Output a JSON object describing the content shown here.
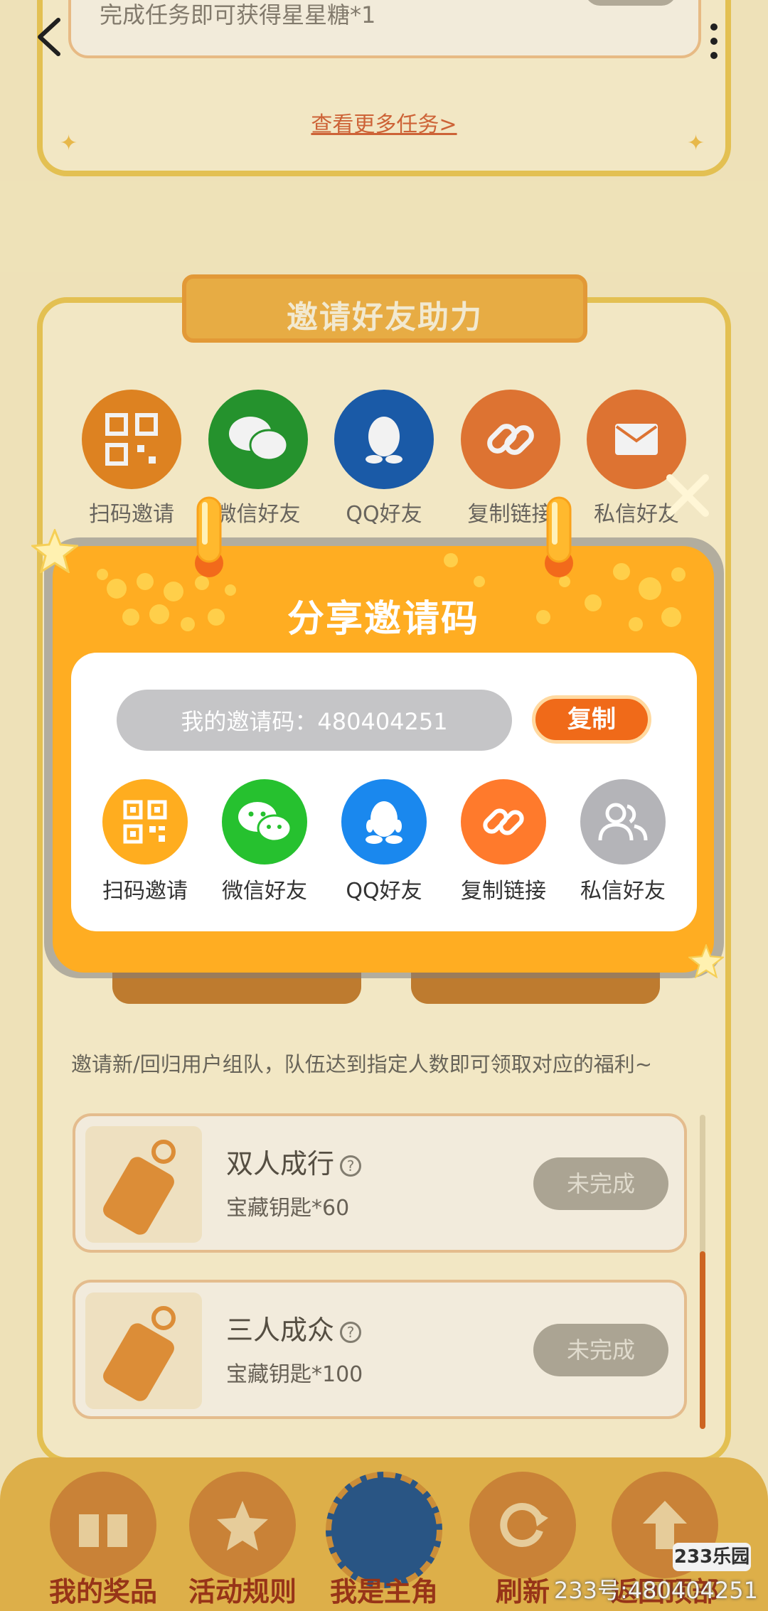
{
  "top_section": {
    "task_text": "完成任务即可获得星星糖*1",
    "more_tasks_link": "查看更多任务>"
  },
  "invite_section": {
    "banner_title": "邀请好友助力",
    "share_options": [
      {
        "label": "扫码邀请",
        "icon": "qr-code-icon",
        "color": "#e98a23"
      },
      {
        "label": "微信好友",
        "icon": "wechat-icon",
        "color": "#279a30"
      },
      {
        "label": "QQ好友",
        "icon": "qq-icon",
        "color": "#1c5fb0"
      },
      {
        "label": "复制链接",
        "icon": "link-icon",
        "color": "#e97a35"
      },
      {
        "label": "私信好友",
        "icon": "message-icon",
        "color": "#e97a35"
      }
    ],
    "team_description": "邀请新/回归用户组队，队伍达到指定人数即可领取对应的福利~",
    "rewards": [
      {
        "title": "双人成行",
        "subtitle": "宝藏钥匙*60",
        "status": "未完成"
      },
      {
        "title": "三人成众",
        "subtitle": "宝藏钥匙*100",
        "status": "未完成"
      }
    ]
  },
  "modal": {
    "title": "分享邀请码",
    "invite_code_label": "我的邀请码：480404251",
    "copy_button": "复制",
    "share_options": [
      {
        "label": "扫码邀请",
        "icon": "qr-code-icon",
        "color": "#ffad1f"
      },
      {
        "label": "微信好友",
        "icon": "wechat-icon",
        "color": "#26c12f"
      },
      {
        "label": "QQ好友",
        "icon": "qq-icon",
        "color": "#1a88ee"
      },
      {
        "label": "复制链接",
        "icon": "link-icon",
        "color": "#ff7a2c"
      },
      {
        "label": "私信好友",
        "icon": "friends-icon",
        "color": "#b4b4b8"
      }
    ]
  },
  "bottom_nav": {
    "items": [
      "我的奖品",
      "活动规则",
      "我是主角",
      "刷新",
      "返回顶部"
    ]
  },
  "watermark": {
    "logo": "233乐园",
    "text": "233号:480404251"
  },
  "colors": {
    "modal_orange": "#ffad22",
    "copy_button": "#f06a19",
    "page_bg": "#fbeec2"
  }
}
